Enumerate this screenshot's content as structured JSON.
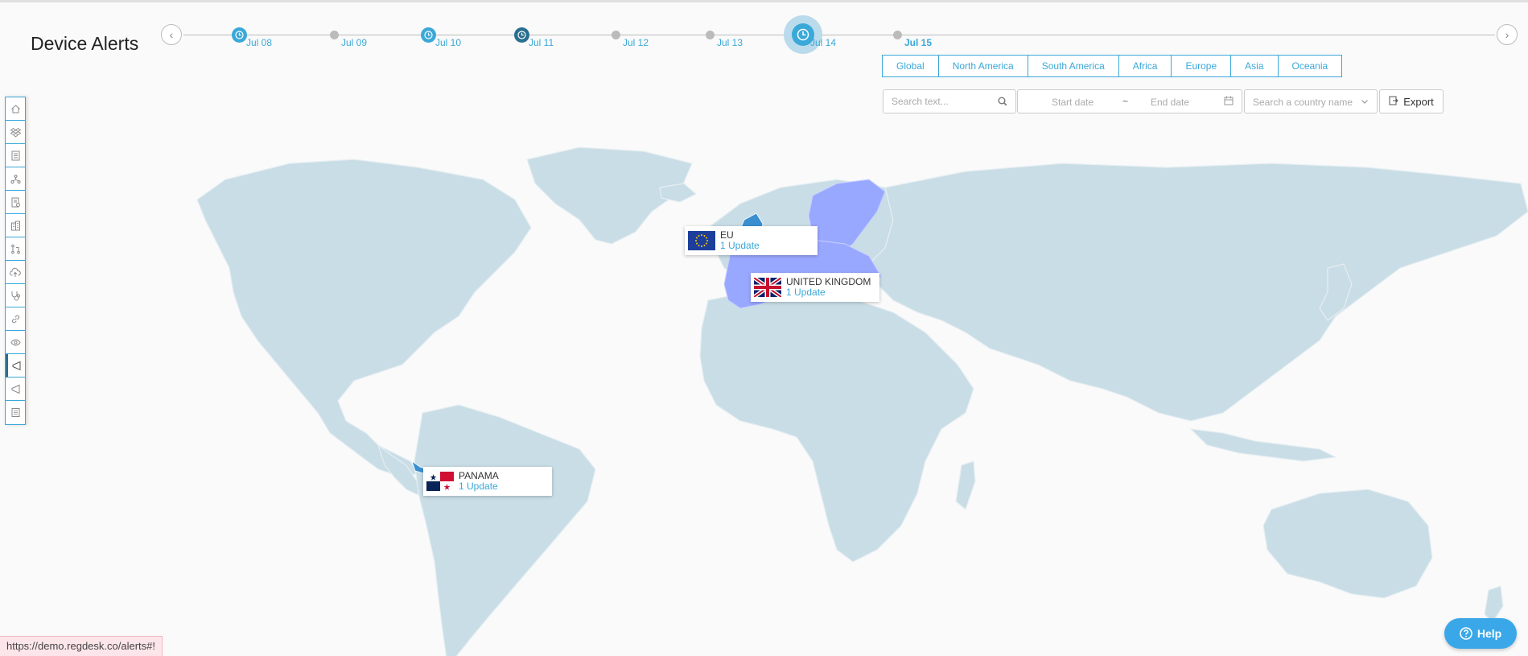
{
  "page": {
    "title": "Device Alerts",
    "status_url": "https://demo.regdesk.co/alerts#!"
  },
  "timeline": {
    "dates": [
      "Jul 08",
      "Jul 09",
      "Jul 10",
      "Jul 11",
      "Jul 12",
      "Jul 13",
      "Jul 14",
      "Jul 15"
    ],
    "clock_dates": [
      "Jul 08",
      "Jul 10",
      "Jul 11",
      "Jul 14"
    ],
    "selected": "Jul 14"
  },
  "regions": [
    "Global",
    "North America",
    "South America",
    "Africa",
    "Europe",
    "Asia",
    "Oceania"
  ],
  "filters": {
    "search_placeholder": "Search text...",
    "start_date_placeholder": "Start date",
    "date_separator": "~",
    "end_date_placeholder": "End date",
    "country_placeholder": "Search a country name",
    "export_label": "Export"
  },
  "sidebar": {
    "icons": [
      "home-icon",
      "dropbox-icon",
      "document-icon",
      "network-icon",
      "report-icon",
      "building-icon",
      "pull-request-icon",
      "cloud-upload-icon",
      "stethoscope-icon",
      "link-icon",
      "eye-icon",
      "megaphone-icon",
      "megaphone-outline-icon",
      "list-icon"
    ],
    "active": "megaphone-icon"
  },
  "markers": [
    {
      "name": "EU",
      "count": "1 Update"
    },
    {
      "name": "UNITED KINGDOM",
      "count": "1 Update"
    },
    {
      "name": "PANAMA",
      "count": "1 Update"
    }
  ],
  "colors": {
    "accent": "#3aa8d8",
    "land": "#c9dde6",
    "highlight": "#99a8ff",
    "help": "#3aa8e8"
  },
  "help_label": "Help"
}
